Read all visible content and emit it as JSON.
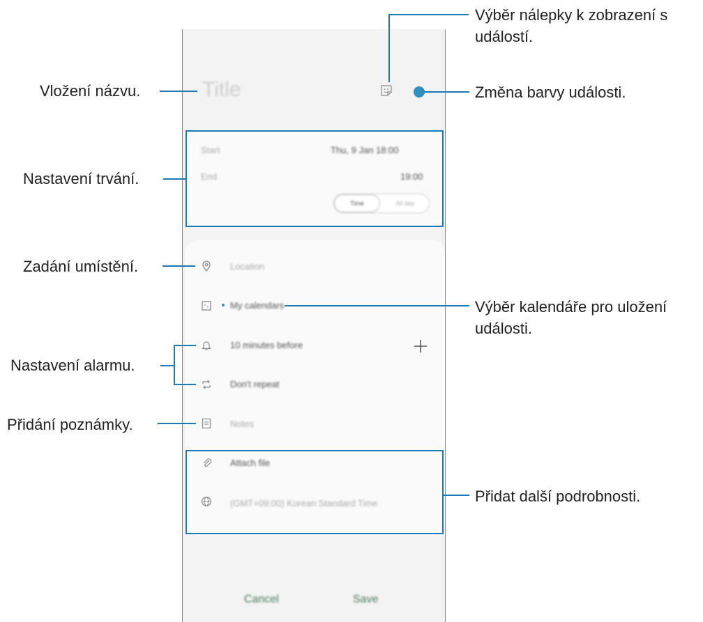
{
  "event": {
    "title_placeholder": "Title",
    "start_label": "Start",
    "start_value": "Thu, 9 Jan   18:00",
    "end_label": "End",
    "end_value": "19:00",
    "toggle_time": "Time",
    "toggle_all_day": "All day",
    "location": "Location",
    "calendar": "My calendars",
    "reminder": "10 minutes before",
    "repeat": "Don't repeat",
    "notes": "Notes",
    "attach": "Attach file",
    "timezone": "(GMT+09:00) Korean Standard Time",
    "cancel": "Cancel",
    "save": "Save",
    "color_accent": "#2f8fc0"
  },
  "annotations": {
    "sticker": "Výběr nálepky k zobrazení s událostí.",
    "sticker_line1": "Výběr nálepky k zobrazení s",
    "sticker_line2": "událostí.",
    "color": "Změna barvy události.",
    "title": "Vložení názvu.",
    "duration": "Nastavení trvání.",
    "location": "Zadání umístění.",
    "calendar_line1": "Výběr kalendáře pro uložení",
    "calendar_line2": "události.",
    "alarm": "Nastavení alarmu.",
    "note": "Přidání poznámky.",
    "more": "Přidat další podrobnosti.",
    "accent_color": "#1d79b5"
  }
}
